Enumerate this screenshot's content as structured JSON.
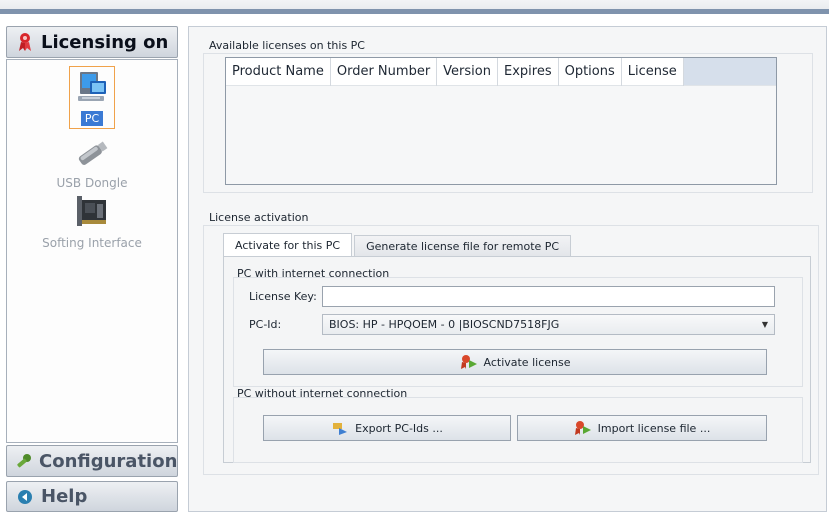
{
  "nav": {
    "licensing": "Licensing on",
    "configuration": "Configuration",
    "help": "Help",
    "items": [
      {
        "label": "PC",
        "icon": "pc-icon",
        "selected": true
      },
      {
        "label": "USB Dongle",
        "icon": "usb-dongle-icon",
        "selected": false
      },
      {
        "label": "Softing Interface",
        "icon": "interface-card-icon",
        "selected": false
      }
    ]
  },
  "licenses": {
    "caption": "Available licenses on this PC",
    "columns": [
      "Product Name",
      "Order Number",
      "Version",
      "Expires",
      "Options",
      "License"
    ],
    "rows": []
  },
  "activation": {
    "caption": "License activation",
    "tabs": [
      "Activate for this PC",
      "Generate license file for remote PC"
    ],
    "online_caption": "PC with internet connection",
    "license_key_label": "License Key:",
    "license_key_value": "",
    "pcid_label": "PC-Id:",
    "pcid_value": "BIOS: HP - HPQOEM - 0 |BIOSCND7518FJG",
    "activate_label": "Activate license",
    "offline_caption": "PC without internet connection",
    "export_label": "Export PC-Ids ...",
    "import_label": "Import license file ..."
  },
  "colors": {
    "accent": "#3b7ad4",
    "header_bar": "#7f93ad",
    "highlight_border": "#f0a24a"
  }
}
